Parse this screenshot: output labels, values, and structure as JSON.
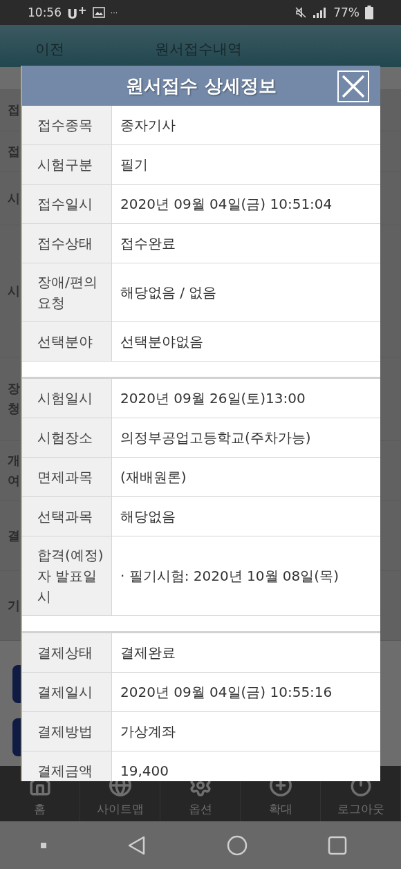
{
  "status_bar": {
    "time": "10:56",
    "carrier": "U$^{+}$",
    "more": "···",
    "battery": "77%"
  },
  "header": {
    "back": "이전",
    "title": "원서접수내역"
  },
  "background_rows": [
    {
      "label": "접"
    },
    {
      "label": "접"
    },
    {
      "label": "시"
    },
    {
      "label": "시"
    },
    {
      "label": "장\n청"
    },
    {
      "label": "개\n여"
    },
    {
      "label": "결"
    },
    {
      "label": "기"
    }
  ],
  "dialog": {
    "title": "원서접수 상세정보",
    "sections": [
      {
        "rows": [
          {
            "label": "접수종목",
            "value": "종자기사"
          },
          {
            "label": "시험구분",
            "value": "필기"
          },
          {
            "label": "접수일시",
            "value": "2020년 09월 04일(금) 10:51:04"
          },
          {
            "label": "접수상태",
            "value": "접수완료"
          },
          {
            "label": "장애/편의\n요청",
            "value": "해당없음 / 없음"
          },
          {
            "label": "선택분야",
            "value": "선택분야없음"
          }
        ]
      },
      {
        "rows": [
          {
            "label": "시험일시",
            "value": "2020년 09월 26일(토)13:00"
          },
          {
            "label": "시험장소",
            "value": "의정부공업고등학교(주차가능)"
          },
          {
            "label": "면제과목",
            "value": "(재배원론)"
          },
          {
            "label": "선택과목",
            "value": "해당없음"
          },
          {
            "label": "합격(예정)\n자 발표일\n시",
            "value": "· 필기시험: 2020년 10월 08일(목)"
          }
        ]
      },
      {
        "rows": [
          {
            "label": "결제상태",
            "value": "결제완료"
          },
          {
            "label": "결제일시",
            "value": "2020년 09월 04일(금) 10:55:16"
          },
          {
            "label": "결제방법",
            "value": "가상계좌"
          },
          {
            "label": "결제금액",
            "value": "19,400"
          }
        ]
      }
    ]
  },
  "bottom_nav": [
    {
      "kind": "home",
      "label": "홈"
    },
    {
      "kind": "globe",
      "label": "사이트맵"
    },
    {
      "kind": "gear",
      "label": "옵션"
    },
    {
      "kind": "plus",
      "label": "확대"
    },
    {
      "kind": "power",
      "label": "로그아웃"
    }
  ]
}
